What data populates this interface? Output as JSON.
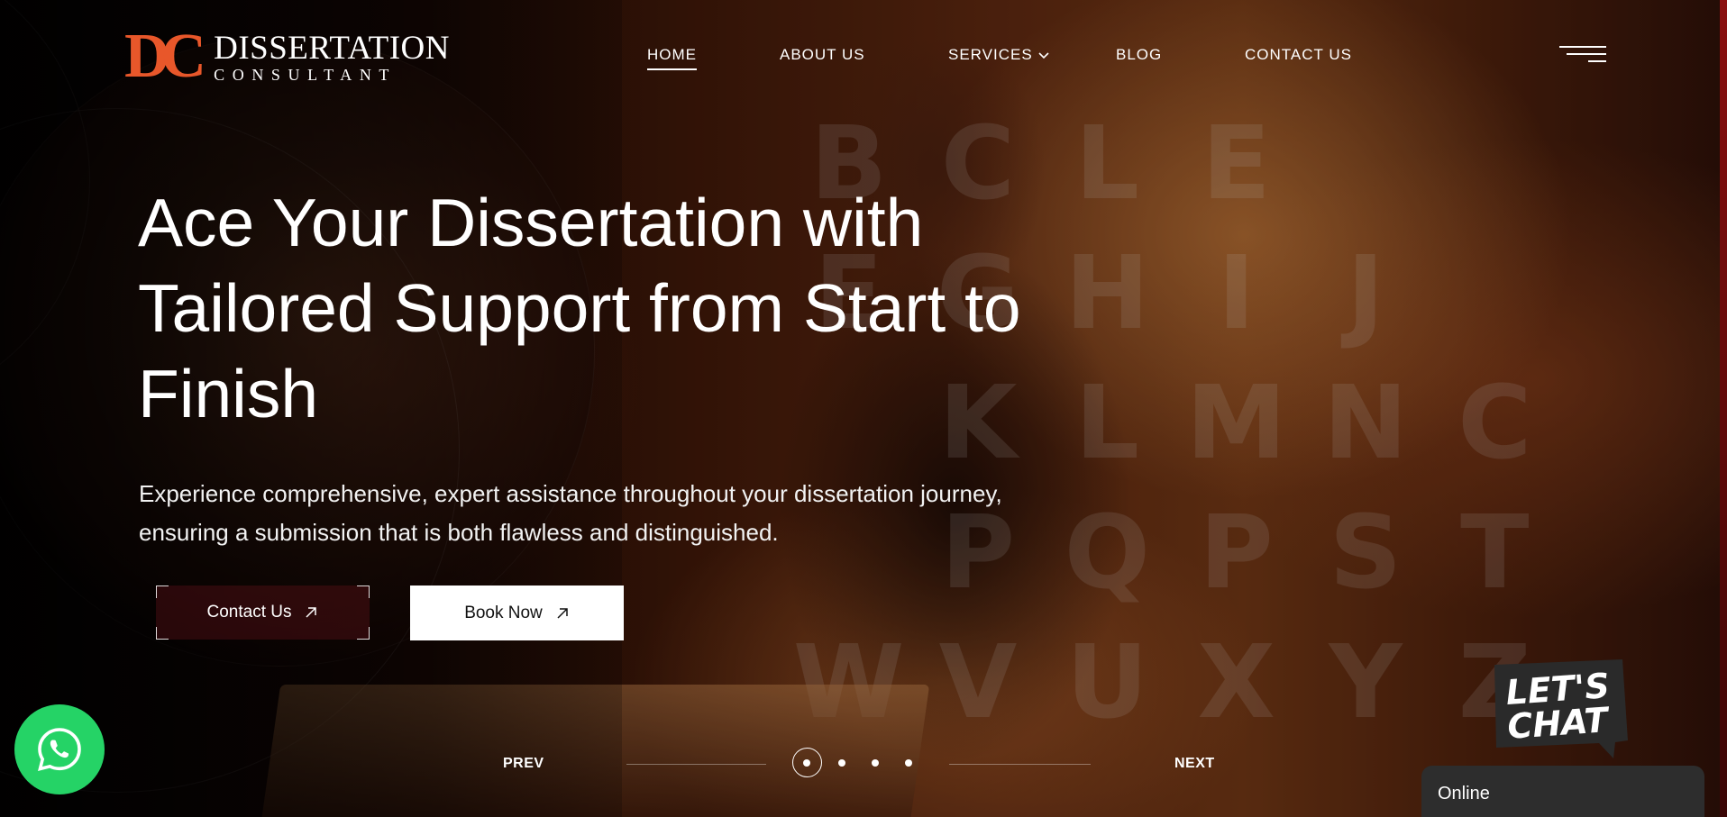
{
  "brand": {
    "mark": "DC",
    "name_line1": "DISSERTATION",
    "name_line2": "CONSULTANT",
    "accent_color": "#e8572a"
  },
  "nav": {
    "items": [
      {
        "label": "HOME",
        "active": true
      },
      {
        "label": "ABOUT US",
        "active": false
      },
      {
        "label": "SERVICES",
        "active": false,
        "has_dropdown": true
      },
      {
        "label": "BLOG",
        "active": false
      },
      {
        "label": "CONTACT US",
        "active": false
      }
    ],
    "menu_icon": "hamburger-icon"
  },
  "hero": {
    "headline": "Ace Your Dissertation with Tailored Support from Start to Finish",
    "subtext": "Experience comprehensive, expert assistance throughout your dissertation journey, ensuring a submission that is both flawless and distinguished.",
    "background_letters": [
      "B",
      "C",
      "L",
      "E",
      "",
      "",
      "E",
      "G",
      "H",
      "I",
      "J",
      "",
      "",
      "K",
      "L",
      "M",
      "N",
      "C",
      "",
      "P",
      "Q",
      "P",
      "S",
      "T",
      "W",
      "V",
      "U",
      "X",
      "Y",
      "Z"
    ],
    "cta_primary": {
      "label": "Contact Us",
      "icon": "arrow-up-right-icon"
    },
    "cta_secondary": {
      "label": "Book Now",
      "icon": "arrow-up-right-icon"
    }
  },
  "slider": {
    "prev_label": "PREV",
    "next_label": "NEXT",
    "slide_count": 4,
    "active_index": 0
  },
  "whatsapp": {
    "icon": "whatsapp-icon",
    "color": "#25d366"
  },
  "chat": {
    "badge_text": "LET'S CHAT",
    "status": "Online"
  }
}
